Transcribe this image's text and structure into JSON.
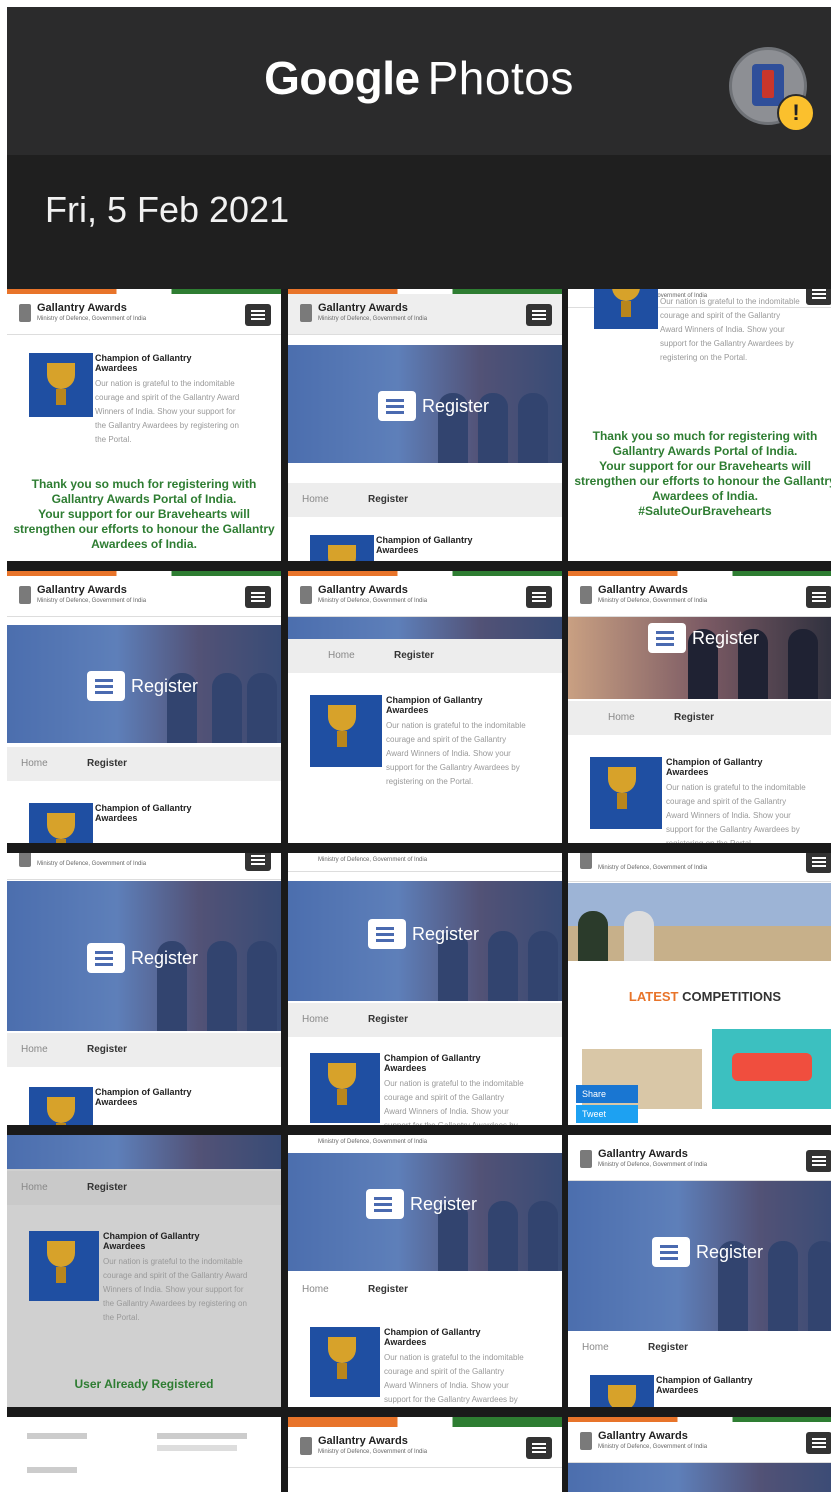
{
  "header": {
    "brand_google": "Google",
    "brand_photos": "Photos",
    "avatar_icon": "profile-avatar",
    "warning_icon": "warning-badge-icon",
    "warning_glyph": "!"
  },
  "date_heading": "Fri, 5 Feb 2021",
  "site": {
    "title": "Gallantry Awards",
    "subtitle": "Ministry of Defence, Government of India",
    "register": "Register",
    "home": "Home",
    "crumb_register": "Register",
    "card_title": "Champion of Gallantry Awardees",
    "card_text": "Our nation is grateful to the indomitable courage and spirit of the Gallantry Award Winners of India. Show your support for the Gallantry Awardees by registering on the Portal.",
    "thanks": "Thank you so much for registering with Gallantry Awards Portal of India.",
    "support": "Your support for our Bravehearts will strengthen our efforts to honour the Gallantry Awardees of India.",
    "hashtag": "#SaluteOurBravehearts",
    "already": "User Already Registered",
    "latest": "LATEST",
    "competitions": "COMPETITIONS",
    "share": "Share",
    "tweet": "Tweet"
  }
}
